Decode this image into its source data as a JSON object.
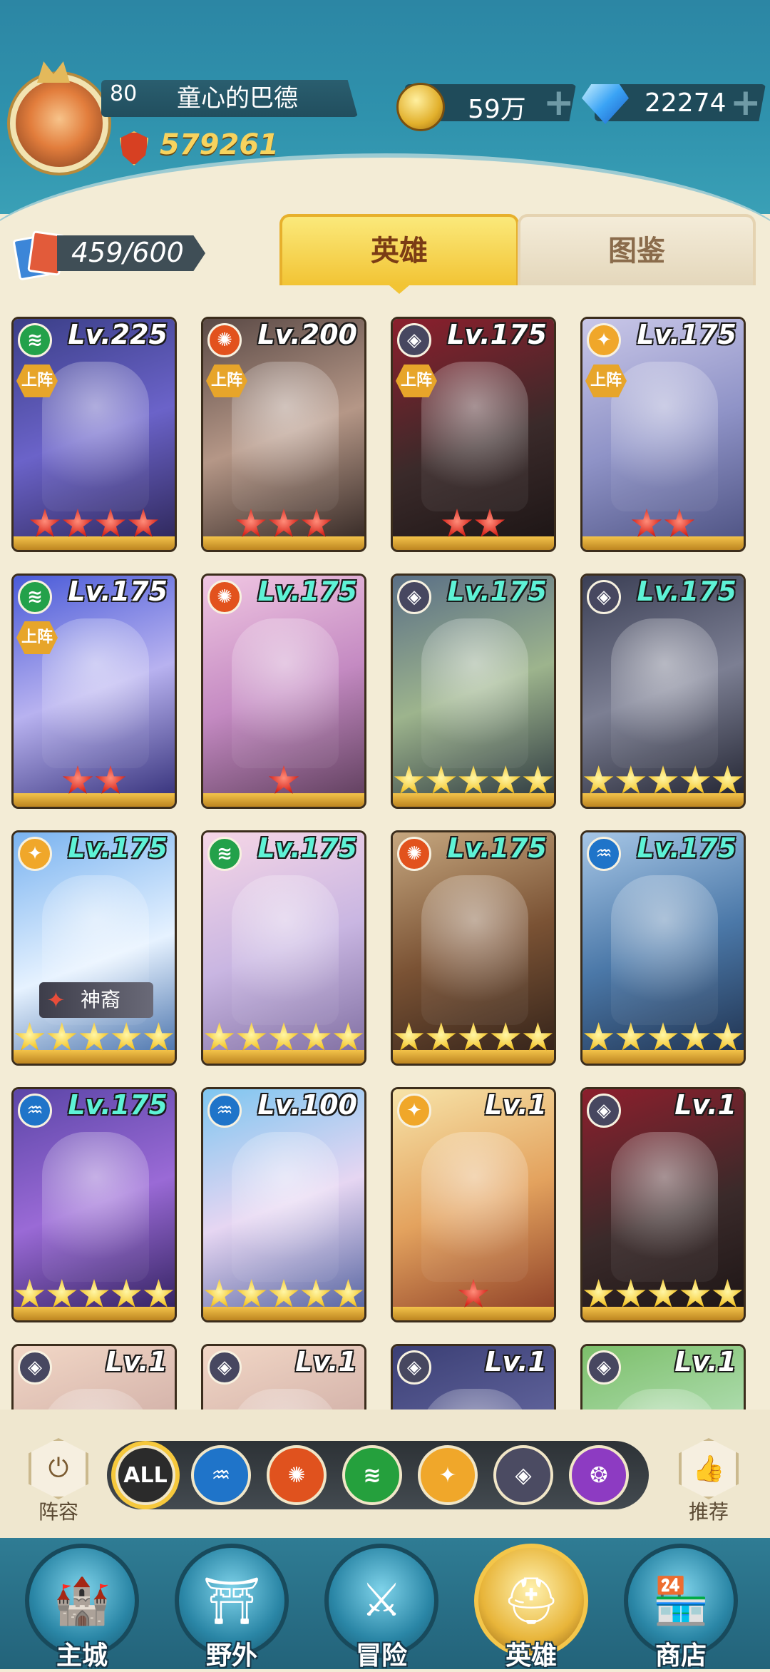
{
  "player": {
    "level": "80",
    "name": "童心的巴德",
    "power": "579261"
  },
  "resources": {
    "gold": "59万",
    "gems": "22274"
  },
  "collection": {
    "count": "459/600"
  },
  "tabs": {
    "heroes": "英雄",
    "atlas": "图鉴"
  },
  "colors": {
    "accent": "#f2c434",
    "header": "#2f92ad",
    "background": "#f3ecd6"
  },
  "heroes": [
    {
      "level": "Lv.225",
      "element": "wind",
      "deployed": true,
      "stars": 4,
      "star_color": "red",
      "level_color": "#ffffff"
    },
    {
      "level": "Lv.200",
      "element": "fire",
      "deployed": true,
      "stars": 3,
      "star_color": "red",
      "level_color": "#ffffff"
    },
    {
      "level": "Lv.175",
      "element": "dark",
      "deployed": true,
      "stars": 2,
      "star_color": "red",
      "level_color": "#ffffff"
    },
    {
      "level": "Lv.175",
      "element": "light",
      "deployed": true,
      "stars": 2,
      "star_color": "red",
      "level_color": "#ffffff"
    },
    {
      "level": "Lv.175",
      "element": "wind",
      "deployed": true,
      "stars": 2,
      "star_color": "red",
      "level_color": "#ffffff"
    },
    {
      "level": "Lv.175",
      "element": "fire",
      "deployed": false,
      "stars": 1,
      "star_color": "red",
      "level_color": "#5ef2d6"
    },
    {
      "level": "Lv.175",
      "element": "dark",
      "deployed": false,
      "stars": 5,
      "star_color": "gold",
      "level_color": "#5ef2d6"
    },
    {
      "level": "Lv.175",
      "element": "dark",
      "deployed": false,
      "stars": 5,
      "star_color": "gold",
      "level_color": "#5ef2d6"
    },
    {
      "level": "Lv.175",
      "element": "light",
      "deployed": false,
      "stars": 5,
      "star_color": "gold",
      "level_color": "#5ef2d6",
      "badge": "神裔"
    },
    {
      "level": "Lv.175",
      "element": "wind",
      "deployed": false,
      "stars": 5,
      "star_color": "gold",
      "level_color": "#5ef2d6"
    },
    {
      "level": "Lv.175",
      "element": "fire",
      "deployed": false,
      "stars": 5,
      "star_color": "gold",
      "level_color": "#5ef2d6"
    },
    {
      "level": "Lv.175",
      "element": "water",
      "deployed": false,
      "stars": 5,
      "star_color": "gold",
      "level_color": "#5ef2d6"
    },
    {
      "level": "Lv.175",
      "element": "water",
      "deployed": false,
      "stars": 5,
      "star_color": "gold",
      "level_color": "#5ef2d6"
    },
    {
      "level": "Lv.100",
      "element": "water",
      "deployed": false,
      "stars": 5,
      "star_color": "gold",
      "level_color": "#ffffff"
    },
    {
      "level": "Lv.1",
      "element": "light",
      "deployed": false,
      "stars": 1,
      "star_color": "red",
      "level_color": "#ffffff"
    },
    {
      "level": "Lv.1",
      "element": "dark",
      "deployed": false,
      "stars": 5,
      "star_color": "gold",
      "level_color": "#ffffff"
    },
    {
      "level": "Lv.1",
      "element": "dark",
      "deployed": false,
      "stars": 0,
      "star_color": "gold",
      "level_color": "#ffffff"
    },
    {
      "level": "Lv.1",
      "element": "dark",
      "deployed": false,
      "stars": 0,
      "star_color": "gold",
      "level_color": "#ffffff"
    },
    {
      "level": "Lv.1",
      "element": "dark",
      "deployed": false,
      "stars": 0,
      "star_color": "gold",
      "level_color": "#ffffff"
    },
    {
      "level": "Lv.1",
      "element": "dark",
      "deployed": false,
      "stars": 0,
      "star_color": "gold",
      "level_color": "#ffffff"
    }
  ],
  "deploy_label": "上阵",
  "filters": {
    "left_label": "阵容",
    "right_label": "推荐",
    "items": [
      {
        "key": "all",
        "label": "ALL",
        "color": "#2b2b2b",
        "active": true
      },
      {
        "key": "water",
        "label": "",
        "color": "#1f74c9",
        "active": false
      },
      {
        "key": "fire",
        "label": "",
        "color": "#e0521e",
        "active": false
      },
      {
        "key": "wind",
        "label": "",
        "color": "#25a03d",
        "active": false
      },
      {
        "key": "light",
        "label": "",
        "color": "#f0a72a",
        "active": false
      },
      {
        "key": "dark",
        "label": "",
        "color": "#4b4b62",
        "active": false
      },
      {
        "key": "arcane",
        "label": "",
        "color": "#8d3bc2",
        "active": false
      }
    ]
  },
  "nav": [
    {
      "key": "main-city",
      "label": "主城",
      "icon": "castle-icon",
      "active": false
    },
    {
      "key": "wild",
      "label": "野外",
      "icon": "portal-icon",
      "active": false
    },
    {
      "key": "adventure",
      "label": "冒险",
      "icon": "sword-icon",
      "active": false
    },
    {
      "key": "heroes",
      "label": "英雄",
      "icon": "helmet-icon",
      "active": true
    },
    {
      "key": "shop",
      "label": "商店",
      "icon": "shop-icon",
      "active": false
    }
  ]
}
